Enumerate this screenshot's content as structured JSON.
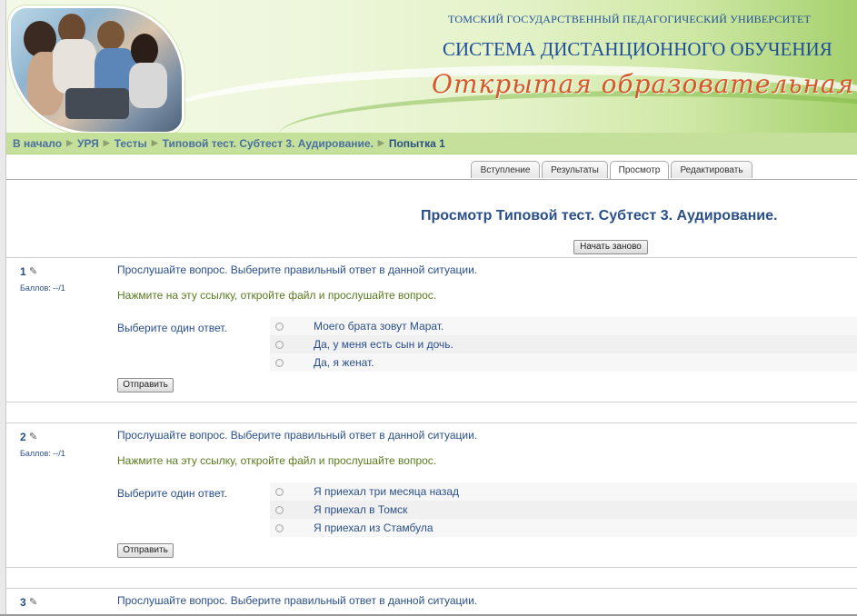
{
  "header": {
    "university": "ТОМСКИЙ ГОСУДАРСТВЕННЫЙ ПЕДАГОГИЧЕСКИЙ УНИВЕРСИТЕТ",
    "system_name": "СИСТЕМА ДИСТАНЦИОННОГО ОБУЧЕНИЯ",
    "slogan": "Открытая образовательная среда"
  },
  "breadcrumb": {
    "items": [
      "В начало",
      "УРЯ",
      "Тесты",
      "Типовой тест. Субтест 3. Аудирование."
    ],
    "current": "Попытка 1"
  },
  "tabs": [
    "Вступление",
    "Результаты",
    "Просмотр",
    "Редактировать"
  ],
  "active_tab": "Просмотр",
  "main": {
    "title": "Просмотр Типовой тест. Субтест 3. Аудирование.",
    "restart_button": "Начать заново"
  },
  "questions": [
    {
      "number": "1",
      "grade": "Баллов: --/1",
      "text": "Прослушайте вопрос. Выберите правильный ответ в данной ситуации.",
      "link": "Нажмите на эту ссылку, откройте файл и прослушайте вопрос.",
      "prompt": "Выберите один ответ.",
      "answers": [
        "Моего брата зовут Марат.",
        "Да, у меня есть сын и дочь.",
        "Да, я женат."
      ],
      "submit": "Отправить"
    },
    {
      "number": "2",
      "grade": "Баллов: --/1",
      "text": "Прослушайте вопрос. Выберите правильный ответ в данной ситуации.",
      "link": "Нажмите на эту ссылку, откройте файл и прослушайте вопрос.",
      "prompt": "Выберите один ответ.",
      "answers": [
        "Я приехал три месяца назад",
        "Я приехал в Томск",
        "Я приехал из Стамбула"
      ],
      "submit": "Отправить"
    },
    {
      "number": "3",
      "text": "Прослушайте вопрос. Выберите правильный ответ в данной ситуации."
    }
  ],
  "icons": {
    "edit": "pencil-icon",
    "breadcrumb_separator": "triangle-right-icon",
    "radio": "radio-button-icon"
  },
  "colors": {
    "link_blue": "#2a4f8c",
    "breadcrumb_bar": "#c4e09a",
    "slogan": "#d9552a"
  }
}
